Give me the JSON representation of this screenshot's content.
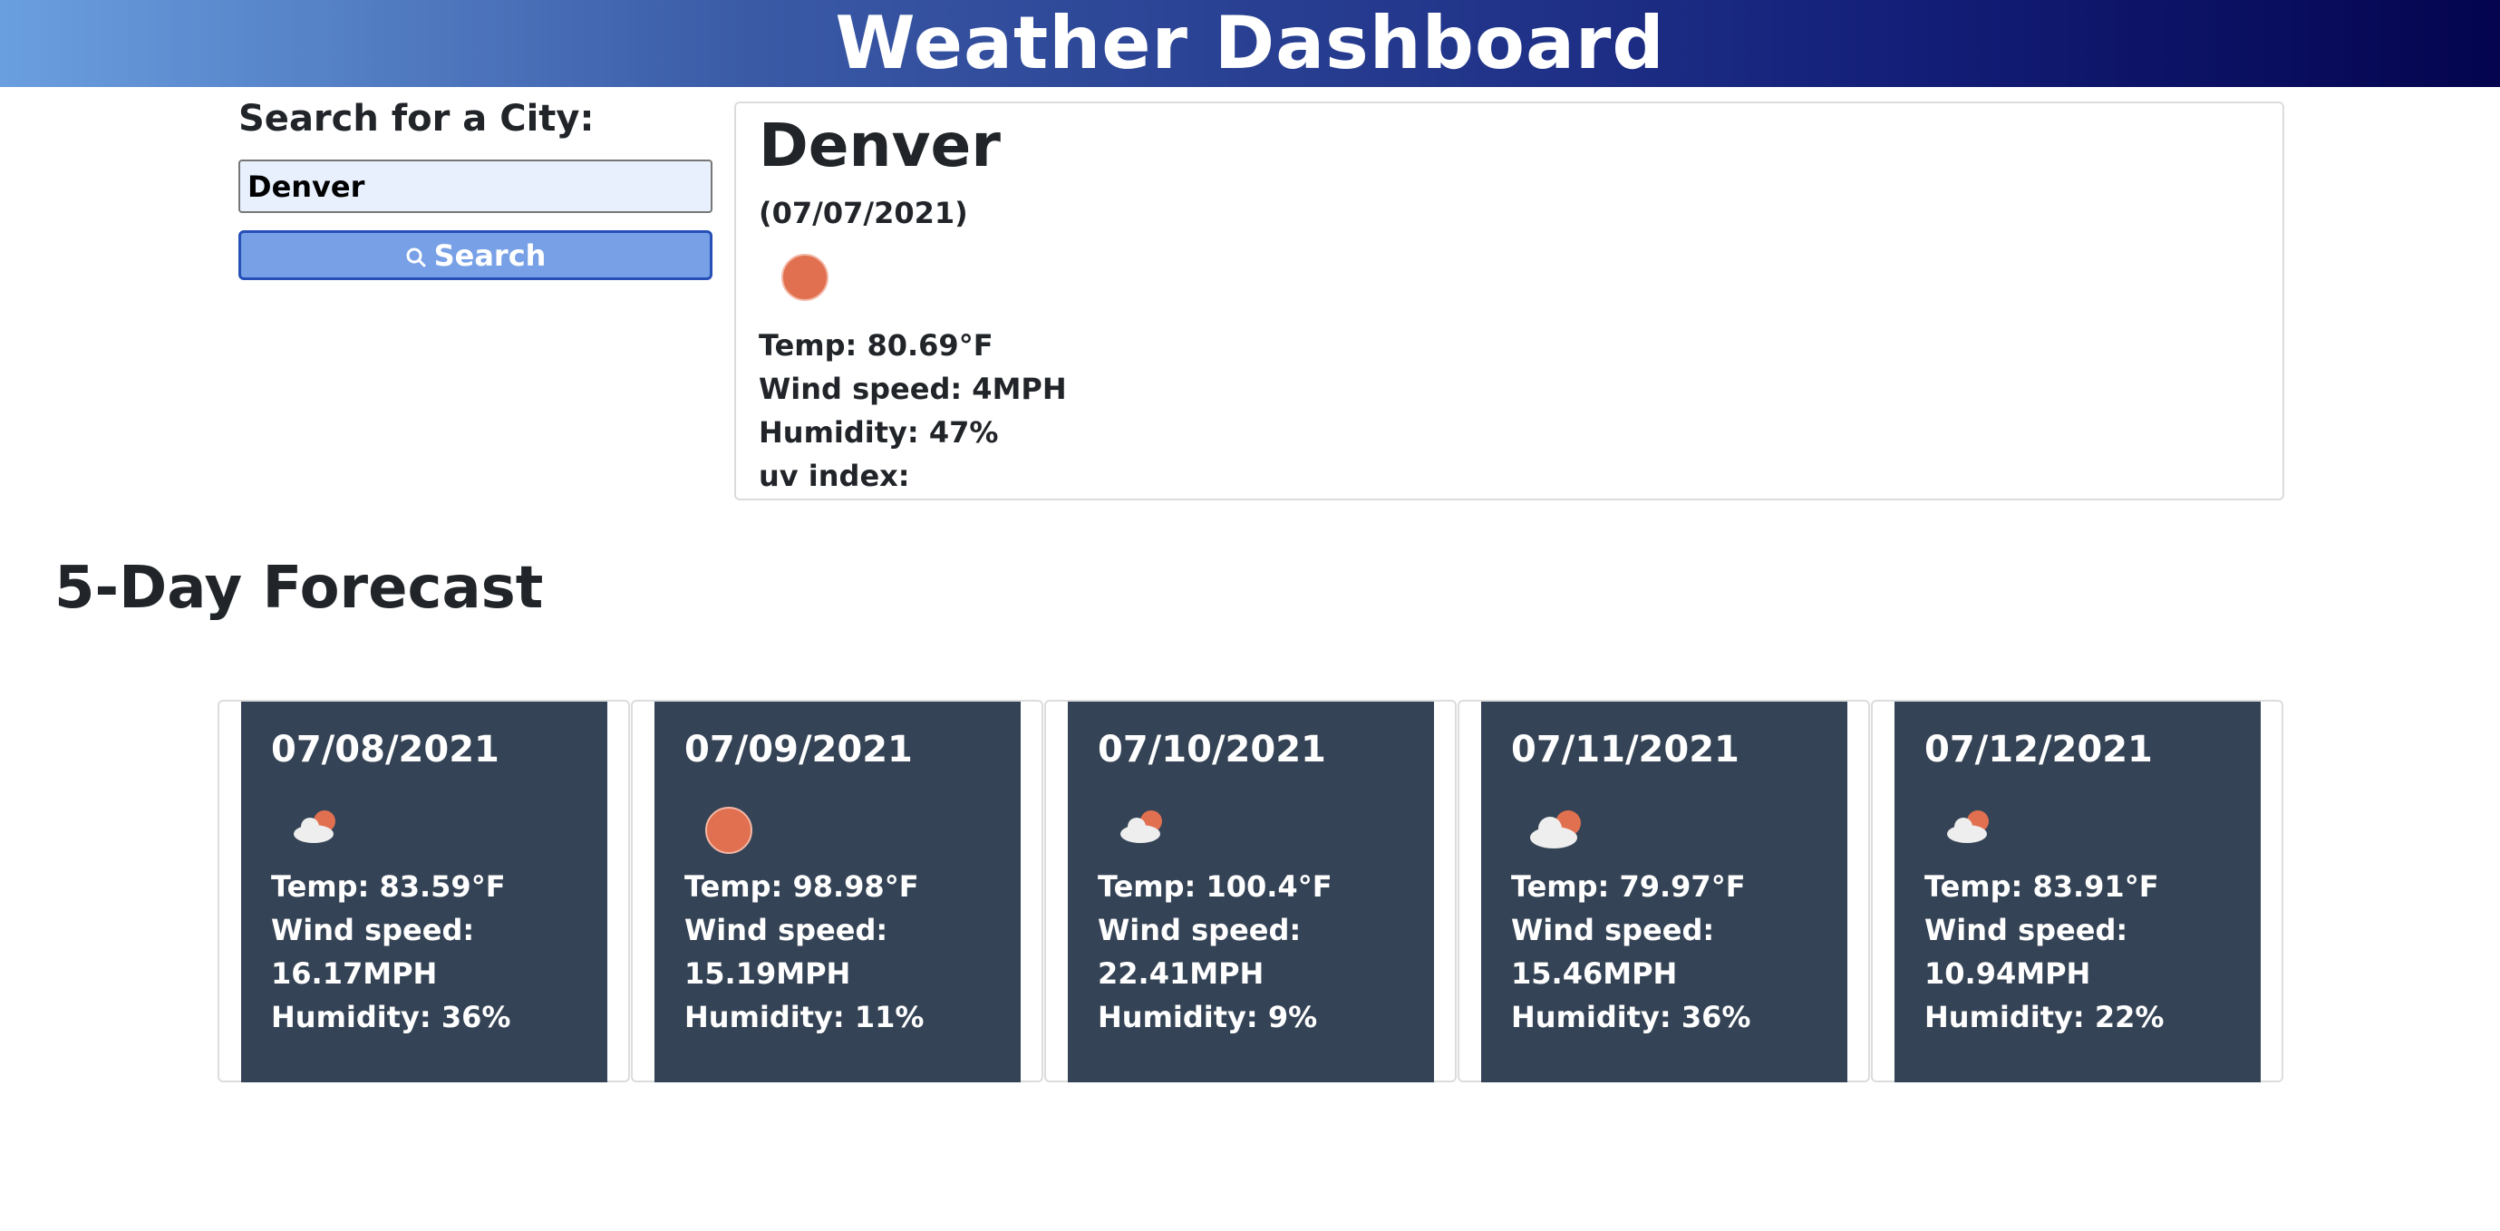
{
  "header": {
    "title": "Weather Dashboard"
  },
  "search": {
    "label": "Search for a City:",
    "input_value": "Denver",
    "button_label": "Search"
  },
  "current": {
    "city": "Denver",
    "date": "(07/07/2021)",
    "icon": "sun-icon",
    "temp": "Temp: 80.69°F",
    "wind": "Wind speed: 4MPH",
    "humidity": "Humidity: 47%",
    "uv": "uv index:"
  },
  "forecast": {
    "title": "5-Day Forecast",
    "days": [
      {
        "date": "07/08/2021",
        "icon": "partly-cloudy-icon",
        "temp": "Temp: 83.59°F",
        "wind_label": "Wind speed:",
        "wind_value": "16.17MPH",
        "humidity": "Humidity: 36%"
      },
      {
        "date": "07/09/2021",
        "icon": "sun-icon",
        "temp": "Temp: 98.98°F",
        "wind_label": "Wind speed:",
        "wind_value": "15.19MPH",
        "humidity": "Humidity: 11%"
      },
      {
        "date": "07/10/2021",
        "icon": "partly-cloudy-icon",
        "temp": "Temp: 100.4°F",
        "wind_label": "Wind speed:",
        "wind_value": "22.41MPH",
        "humidity": "Humidity: 9%"
      },
      {
        "date": "07/11/2021",
        "icon": "partly-cloudy-icon",
        "temp": "Temp: 79.97°F",
        "wind_label": "Wind speed:",
        "wind_value": "15.46MPH",
        "humidity": "Humidity: 36%"
      },
      {
        "date": "07/12/2021",
        "icon": "partly-cloudy-icon",
        "temp": "Temp: 83.91°F",
        "wind_label": "Wind speed:",
        "wind_value": "10.94MPH",
        "humidity": "Humidity: 22%"
      }
    ]
  },
  "colors": {
    "header_gradient_start": "#6a9fdf",
    "header_gradient_end": "#04044f",
    "button_bg": "#77a0e6",
    "card_bg": "#344355",
    "sun": "#e07050"
  }
}
